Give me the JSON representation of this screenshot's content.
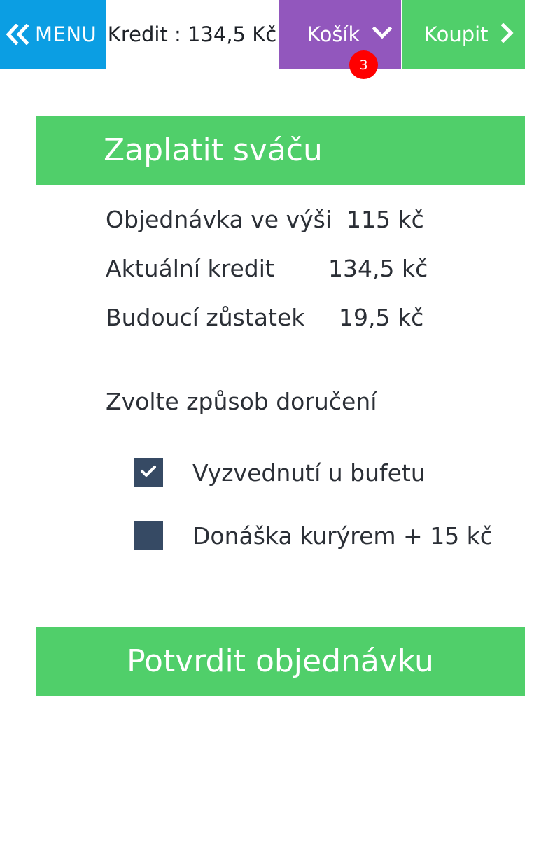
{
  "header": {
    "menu_label": "MENU",
    "menu_icon": "double-chevron-left-icon",
    "credit_text": "Kredit : 134,5 Kč",
    "cart_label": "Košík",
    "cart_icon": "chevron-down-icon",
    "cart_badge_count": "3",
    "buy_label": "Koupit",
    "buy_icon": "chevron-right-icon"
  },
  "section": {
    "title": "Zaplatit sváču"
  },
  "summary": [
    {
      "label": "Objednávka ve výši",
      "value": "115 kč"
    },
    {
      "label": "Aktuální kredit",
      "value": "134,5 kč"
    },
    {
      "label": "Budoucí zůstatek",
      "value": "19,5 kč"
    }
  ],
  "delivery": {
    "title": "Zvolte způsob doručení",
    "options": [
      {
        "label": "Vyzvednutí u bufetu",
        "checked": true
      },
      {
        "label": "Donáška kurýrem + 15 kč",
        "checked": false
      }
    ]
  },
  "confirm_label": "Potvrdit objednávku",
  "colors": {
    "menu_blue": "#0b9ee3",
    "cart_purple": "#9257bd",
    "accent_green": "#50cf6a",
    "badge_red": "#ff0000",
    "checkbox_navy": "#364a64",
    "text_dark": "#2b2f36"
  }
}
